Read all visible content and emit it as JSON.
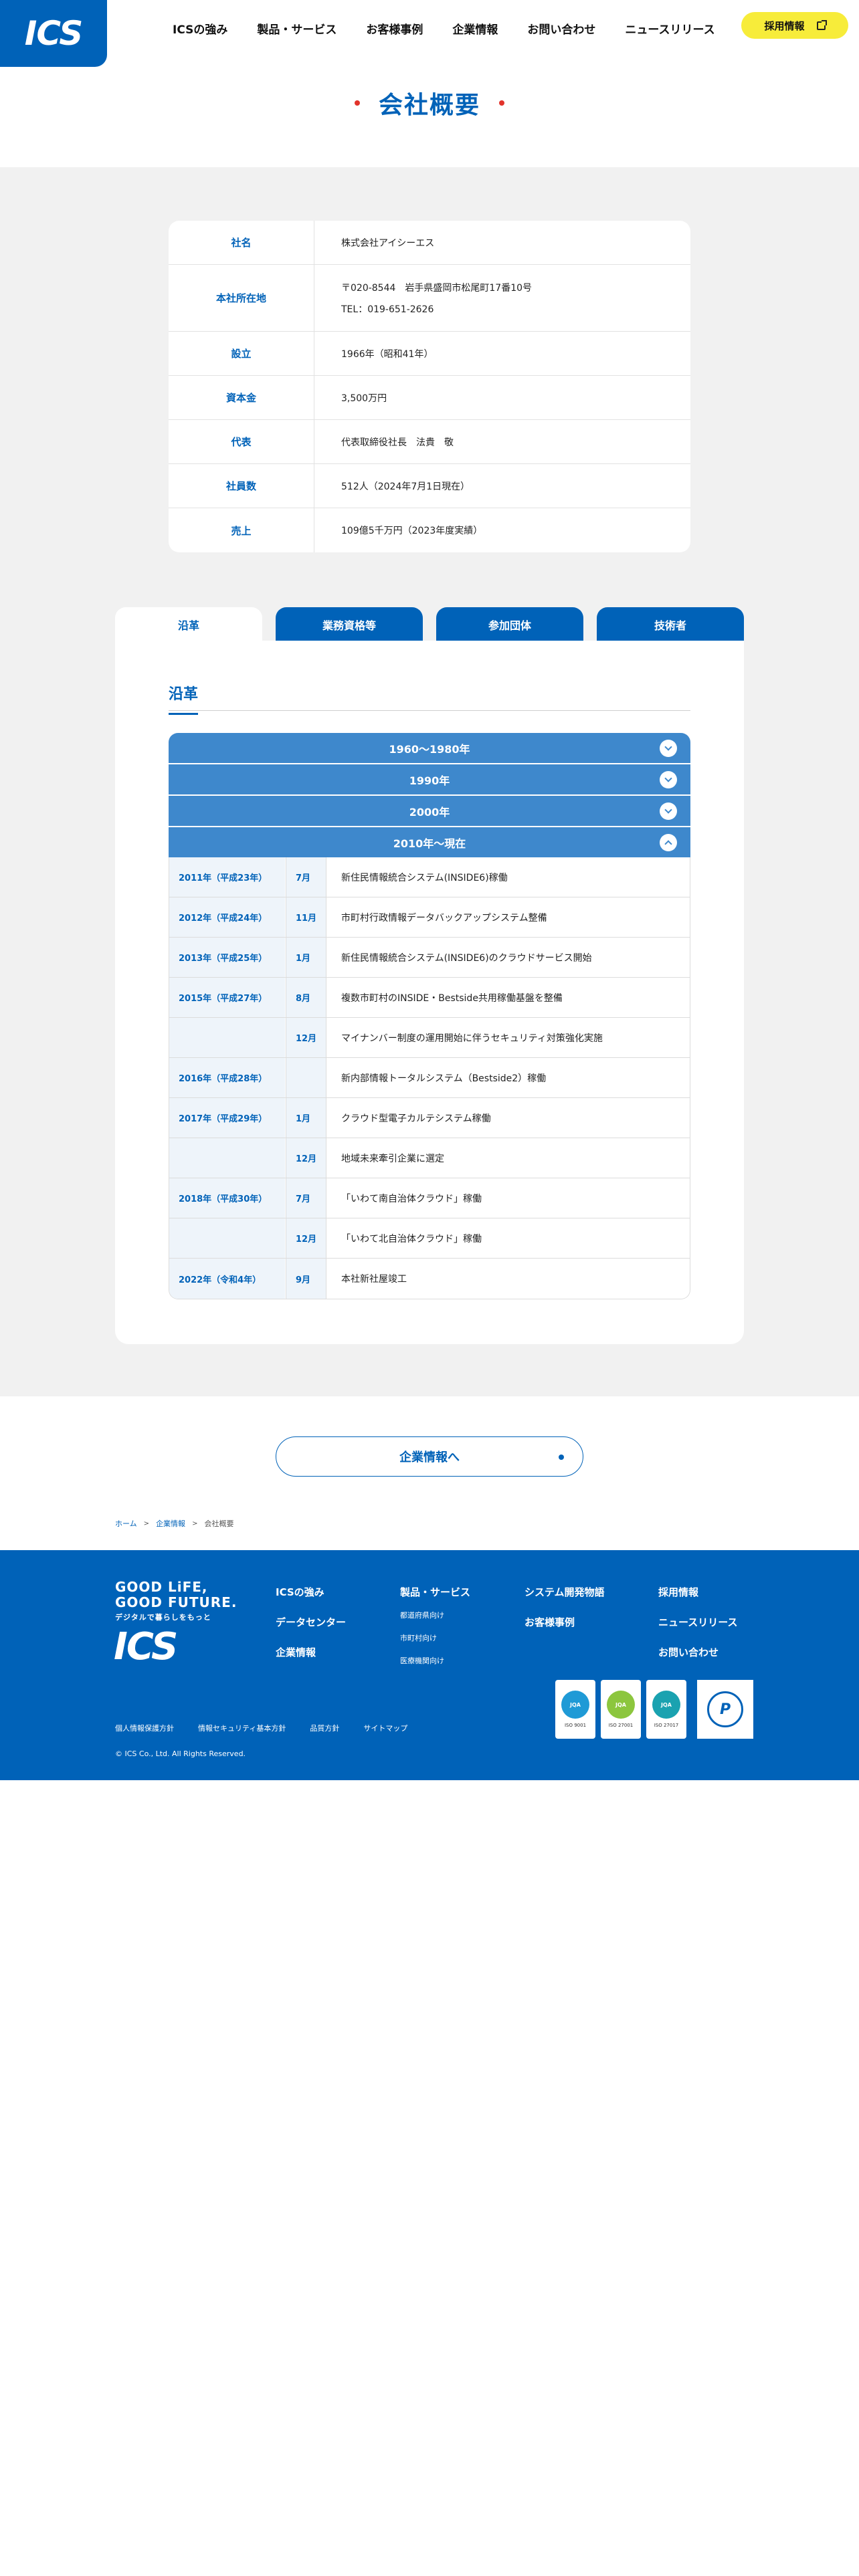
{
  "header": {
    "logo": "ICS",
    "nav": [
      "ICSの強み",
      "製品・サービス",
      "お客様事例",
      "企業情報",
      "お問い合わせ",
      "ニュースリリース"
    ],
    "recruit": "採用情報"
  },
  "page_title": "会社概要",
  "overview": [
    {
      "label": "社名",
      "lines": [
        "株式会社アイシーエス"
      ]
    },
    {
      "label": "本社所在地",
      "lines": [
        "〒020-8544　岩手県盛岡市松尾町17番10号",
        "TEL：019-651-2626"
      ]
    },
    {
      "label": "設立",
      "lines": [
        "1966年（昭和41年）"
      ]
    },
    {
      "label": "資本金",
      "lines": [
        "3,500万円"
      ]
    },
    {
      "label": "代表",
      "lines": [
        "代表取締役社長　法貴　敬"
      ]
    },
    {
      "label": "社員数",
      "lines": [
        "512人（2024年7月1日現在）"
      ]
    },
    {
      "label": "売上",
      "lines": [
        "109億5千万円（2023年度実績）"
      ]
    }
  ],
  "tabs": [
    "沿革",
    "業務資格等",
    "参加団体",
    "技術者"
  ],
  "history": {
    "heading": "沿革",
    "periods": [
      "1960〜1980年",
      "1990年",
      "2000年",
      "2010年〜現在"
    ],
    "rows": [
      {
        "year": "2011年（平成23年）",
        "month": "7月",
        "event": "新住民情報統合システム(INSIDE6)稼働"
      },
      {
        "year": "2012年（平成24年）",
        "month": "11月",
        "event": "市町村行政情報データバックアップシステム整備"
      },
      {
        "year": "2013年（平成25年）",
        "month": "1月",
        "event": "新住民情報統合システム(INSIDE6)のクラウドサービス開始"
      },
      {
        "year": "2015年（平成27年）",
        "month": "8月",
        "event": "複数市町村のINSIDE・Bestside共用稼働基盤を整備"
      },
      {
        "year": "",
        "month": "12月",
        "event": "マイナンバー制度の運用開始に伴うセキュリティ対策強化実施"
      },
      {
        "year": "2016年（平成28年）",
        "month": "",
        "event": "新内部情報トータルシステム（Bestside2）稼働"
      },
      {
        "year": "2017年（平成29年）",
        "month": "1月",
        "event": "クラウド型電子カルテシステム稼働"
      },
      {
        "year": "",
        "month": "12月",
        "event": "地域未来牽引企業に選定"
      },
      {
        "year": "2018年（平成30年）",
        "month": "7月",
        "event": "「いわて南自治体クラウド」稼働"
      },
      {
        "year": "",
        "month": "12月",
        "event": "「いわて北自治体クラウド」稼働"
      },
      {
        "year": "2022年（令和4年）",
        "month": "9月",
        "event": "本社新社屋竣工"
      }
    ]
  },
  "corp_button": "企業情報へ",
  "breadcrumb": [
    "ホーム",
    "企業情報",
    "会社概要"
  ],
  "footer": {
    "tagline1": "GOOD LiFE,",
    "tagline1b": "GOOD FUTURE.",
    "tagline2": "デジタルで暮らしをもっと",
    "logo": "ICS",
    "col1": [
      "ICSの強み",
      "データセンター",
      "企業情報"
    ],
    "col2_main": "製品・サービス",
    "col2_sub": [
      "都道府県向け",
      "市町村向け",
      "医療機関向け"
    ],
    "col3": [
      "システム開発物語",
      "お客様事例"
    ],
    "col4": [
      "採用情報",
      "ニュースリリース",
      "お問い合わせ"
    ],
    "certs": [
      "ISO 9001",
      "ISO 27001",
      "ISO 27017"
    ],
    "links": [
      "個人情報保護方針",
      "情報セキュリティ基本方針",
      "品質方針",
      "サイトマップ"
    ],
    "copyright": "© ICS Co., Ltd. All Rights Reserved."
  },
  "colors": {
    "brand": "#0062b8",
    "accordion": "#3e88cc",
    "accent_red": "#e2332b",
    "recruit_yellow": "#f7ec3a"
  }
}
